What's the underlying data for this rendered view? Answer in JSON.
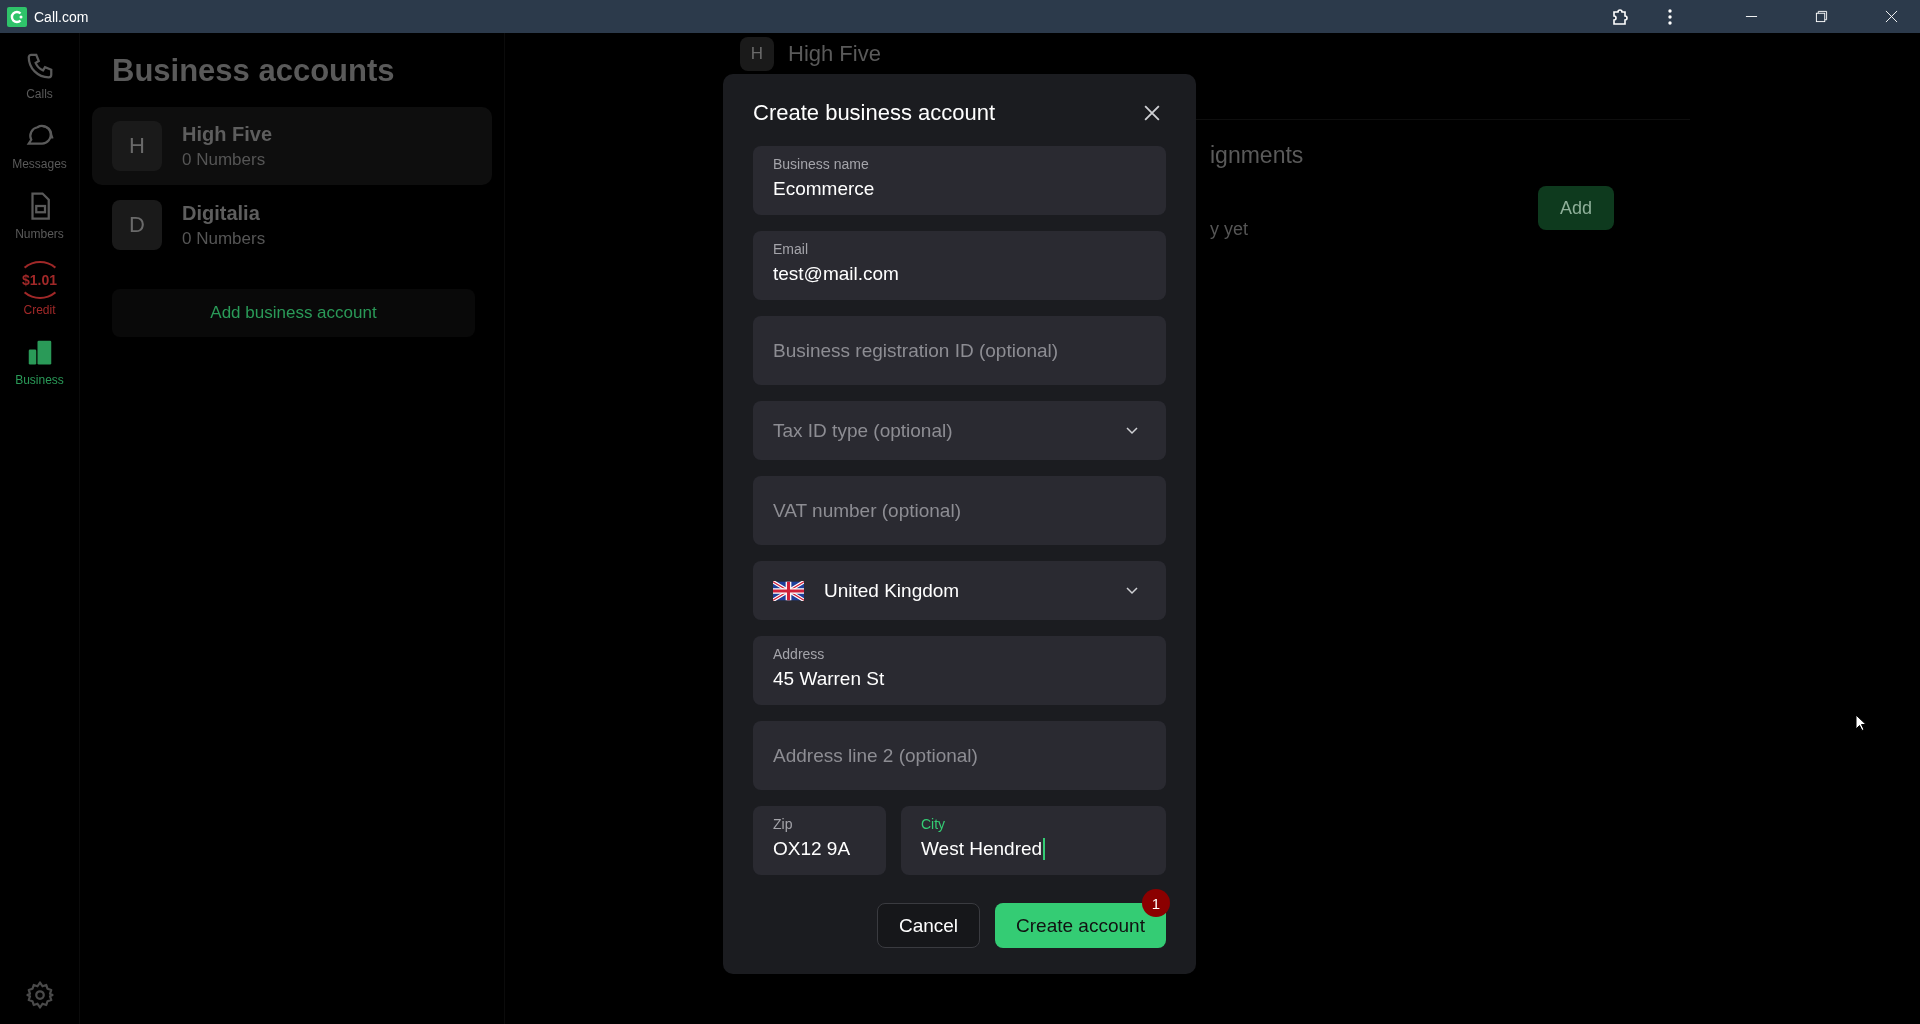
{
  "window": {
    "title": "Call.com"
  },
  "nav": [
    {
      "kind": "phone",
      "label": "Calls",
      "selected": false
    },
    {
      "kind": "chat",
      "label": "Messages",
      "selected": false
    },
    {
      "kind": "sim",
      "label": "Numbers",
      "selected": false
    },
    {
      "kind": "credit",
      "label": "Credit",
      "amount": "$1.01",
      "selected": false
    },
    {
      "kind": "building",
      "label": "Business",
      "selected": true
    }
  ],
  "accounts": {
    "title": "Business accounts",
    "items": [
      {
        "initial": "H",
        "name": "High Five",
        "count": "0 Numbers",
        "selected": true
      },
      {
        "initial": "D",
        "name": "Digitalia",
        "count": "0 Numbers",
        "selected": false
      }
    ],
    "add_button": "Add business account"
  },
  "detail": {
    "initial": "H",
    "name": "High Five",
    "section_title": "ignments",
    "add_button": "Add",
    "empty_text": "y yet"
  },
  "dialog": {
    "title": "Create business account",
    "fields": [
      {
        "kind": "text",
        "label": "Business name",
        "value": "Ecommerce"
      },
      {
        "kind": "text",
        "label": "Email",
        "value": "test@mail.com"
      },
      {
        "kind": "text",
        "placeholder": "Business registration ID (optional)"
      },
      {
        "kind": "select",
        "placeholder": "Tax ID type (optional)"
      },
      {
        "kind": "text",
        "placeholder": "VAT number (optional)"
      },
      {
        "kind": "country",
        "value": "United Kingdom"
      },
      {
        "kind": "text",
        "label": "Address",
        "value": "45 Warren St"
      },
      {
        "kind": "text",
        "placeholder": "Address line 2 (optional)"
      }
    ],
    "row": [
      {
        "label": "Zip",
        "value": "OX12 9A",
        "focused": false
      },
      {
        "label": "City",
        "value": "West Hendred",
        "focused": true
      }
    ],
    "cancel": "Cancel",
    "submit": "Create account",
    "badge": "1"
  }
}
